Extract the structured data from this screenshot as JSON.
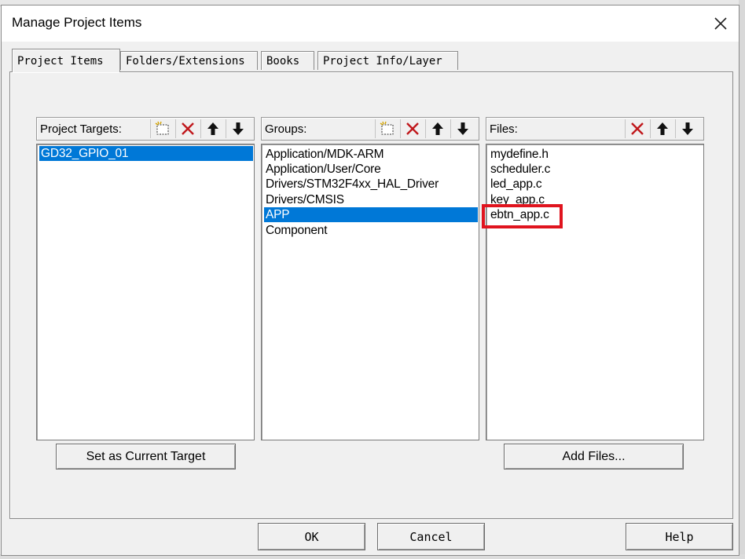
{
  "window": {
    "title": "Manage Project Items"
  },
  "tabs": [
    {
      "label": "Project Items",
      "active": true
    },
    {
      "label": "Folders/Extensions",
      "active": false
    },
    {
      "label": "Books",
      "active": false
    },
    {
      "label": "Project Info/Layer",
      "active": false
    }
  ],
  "targets": {
    "header": "Project Targets:",
    "items": [
      {
        "label": "GD32_GPIO_01",
        "selected": true
      }
    ],
    "toolbar_icons": [
      "new-icon",
      "delete-icon",
      "move-up-icon",
      "move-down-icon"
    ]
  },
  "groups": {
    "header": "Groups:",
    "items": [
      {
        "label": "Application/MDK-ARM",
        "selected": false
      },
      {
        "label": "Application/User/Core",
        "selected": false
      },
      {
        "label": "Drivers/STM32F4xx_HAL_Driver",
        "selected": false
      },
      {
        "label": "Drivers/CMSIS",
        "selected": false
      },
      {
        "label": "APP",
        "selected": true
      },
      {
        "label": "Component",
        "selected": false
      }
    ],
    "toolbar_icons": [
      "new-icon",
      "delete-icon",
      "move-up-icon",
      "move-down-icon"
    ]
  },
  "files": {
    "header": "Files:",
    "items": [
      {
        "label": "mydefine.h"
      },
      {
        "label": "scheduler.c"
      },
      {
        "label": "led_app.c"
      },
      {
        "label": "key_app.c"
      },
      {
        "label": "ebtn_app.c",
        "highlighted": true
      }
    ],
    "toolbar_icons": [
      "delete-icon",
      "move-up-icon",
      "move-down-icon"
    ]
  },
  "buttons": {
    "set_current_target": "Set as Current Target",
    "add_files": "Add Files...",
    "ok": "OK",
    "cancel": "Cancel",
    "help": "Help"
  },
  "colors": {
    "selection": "#0078d7",
    "highlight_box": "#e0141e",
    "delete_icon": "#c0181c"
  }
}
